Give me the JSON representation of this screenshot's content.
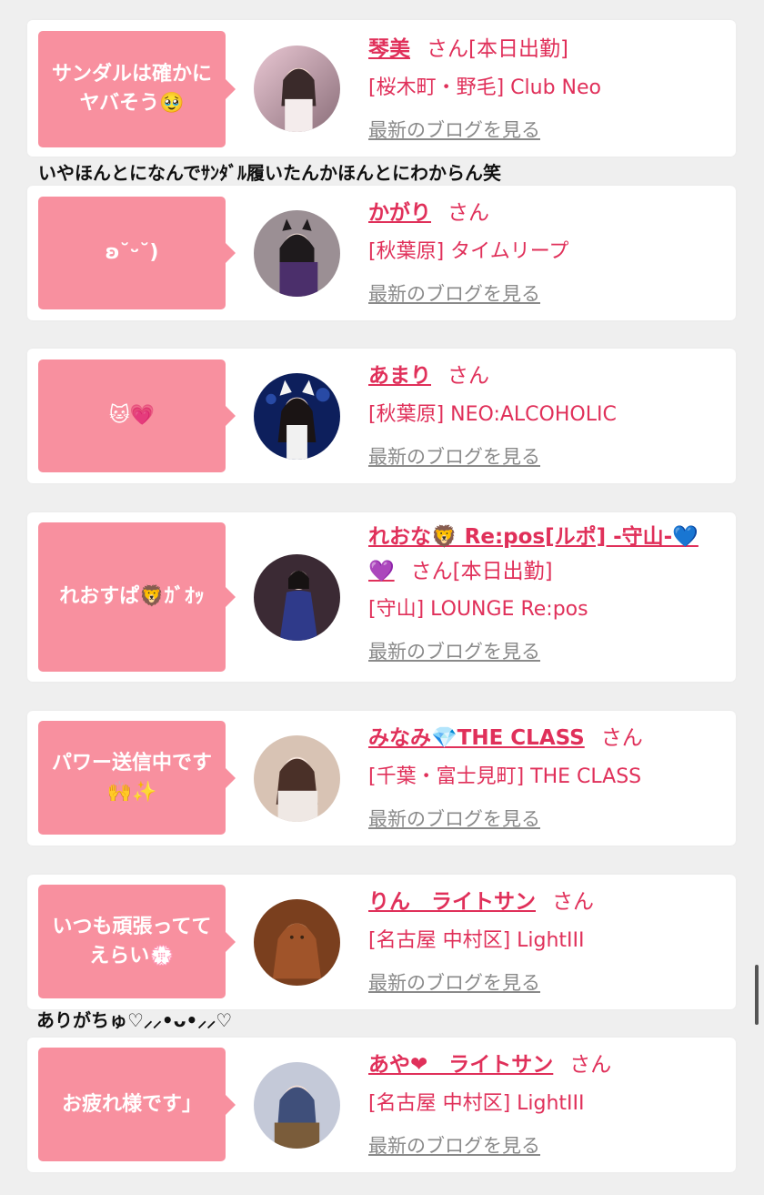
{
  "cards": [
    {
      "bubble": "サンダルは確かに\nヤバそう🥹",
      "name": "琴美",
      "honorific": "さん[本日出勤]",
      "shop": "[桜木町・野毛] Club Neo",
      "blog": "最新のブログを見る"
    },
    {
      "bubble": "ʚ˘ᵕ˘)",
      "name": "かがり",
      "honorific": "さん",
      "shop": "[秋葉原] タイムリープ",
      "blog": "最新のブログを見る"
    },
    {
      "bubble": "🐱💗",
      "name": "あまり",
      "honorific": "さん",
      "shop": "[秋葉原] NEO:ALCOHOLIC",
      "blog": "最新のブログを見る"
    },
    {
      "bubble": "れおすぱ🦁ｶﾞｵｯ",
      "name": "れおな🦁 Re:pos[ルポ] -守山-💙💜",
      "honorific": "さん[本日出勤]",
      "shop": "[守山] LOUNGE Re:pos",
      "blog": "最新のブログを見る"
    },
    {
      "bubble": "パワー送信中です\n🙌✨",
      "name": "みなみ💎THE CLASS",
      "honorific": "さん",
      "shop": "[千葉・富士見町] THE CLASS",
      "blog": "最新のブログを見る"
    },
    {
      "bubble": "いつも頑張ってて\nえらい💮",
      "name": "りん　ライトサン",
      "honorific": "さん",
      "shop": "[名古屋 中村区] LightIII",
      "blog": "最新のブログを見る"
    },
    {
      "bubble": "お疲れ様です」",
      "name": "あや❤　ライトサン",
      "honorific": "さん",
      "shop": "[名古屋 中村区] LightIII",
      "blog": "最新のブログを見る"
    }
  ],
  "comments": {
    "after_card_1": "いやほんとになんでｻﾝﾀﾞﾙ履いたんかほんとにわからん笑",
    "after_card_6": "ありがちゅ♡⸝⸝•ᴗ•⸝⸝♡"
  },
  "colors": {
    "bubble": "#f8909f",
    "accent": "#e0305a",
    "link_gray": "#8a8a8a",
    "background": "#efefef"
  }
}
